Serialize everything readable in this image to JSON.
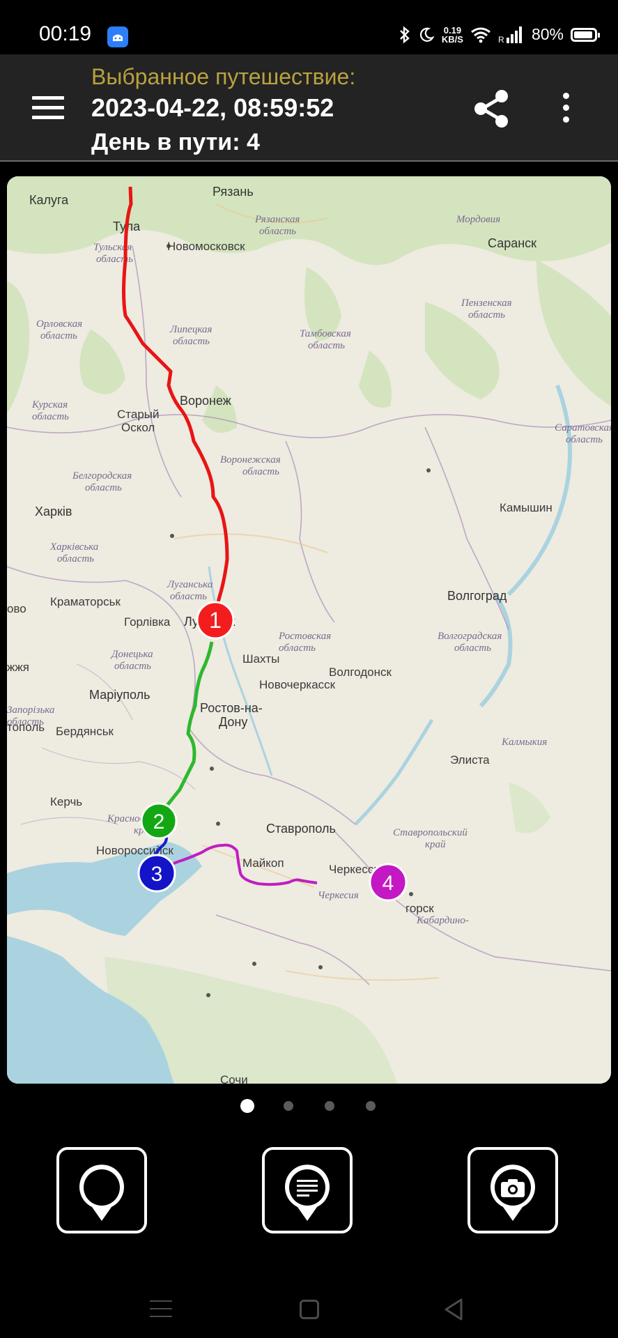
{
  "status_bar": {
    "time": "00:19",
    "speed_value": "0.19",
    "speed_unit": "KB/S",
    "battery": "80%",
    "icons": [
      "app-icon",
      "bluetooth-icon",
      "moon-icon",
      "wifi-icon",
      "signal-icon",
      "battery-icon"
    ]
  },
  "header": {
    "subtitle": "Выбранное путешествие:",
    "title": "2023-04-22, 08:59:52",
    "day_label": "День в пути: 4",
    "icons": [
      "menu-icon",
      "share-icon",
      "more-vert-icon"
    ]
  },
  "map": {
    "cities": [
      "Калуга",
      "Рязань",
      "Тула",
      "Новомосковск",
      "Саранск",
      "Воронеж",
      "Старый Оскол",
      "Харків",
      "Камышин",
      "Краматорськ",
      "Горлівка",
      "Луганськ",
      "Волгоград",
      "Шахты",
      "Волгодонск",
      "Новочеркасск",
      "Маріуполь",
      "Ростов-на-Дону",
      "Бердянськ",
      "Элиста",
      "Керчь",
      "Ставрополь",
      "Новороссийск",
      "Майкоп",
      "Черкесск",
      "Сочи"
    ],
    "regions": [
      "Рязанская область",
      "Мордовия",
      "Тульская область",
      "Пензенская область",
      "Орловская область",
      "Липецкая область",
      "Тамбовская область",
      "Курская область",
      "Саратовская область",
      "Белгородская область",
      "Воронежская область",
      "Харківська область",
      "Волгоградская область",
      "Луганська область",
      "Ростовская область",
      "Донецька область",
      "Запорізька область",
      "Калмыкия",
      "Краснодарский край",
      "Ставропольский край",
      "Черкесия",
      "Кабардино-"
    ],
    "edge_labels": [
      "ово",
      "жжя",
      "тополь",
      "горск",
      "Сочи"
    ],
    "markers": [
      {
        "label": "1",
        "color": "#f41d1d"
      },
      {
        "label": "2",
        "color": "#13a813"
      },
      {
        "label": "3",
        "color": "#1313c8"
      },
      {
        "label": "4",
        "color": "#c418c4"
      }
    ],
    "routes": [
      {
        "day": "1",
        "color": "#e81515"
      },
      {
        "day": "2",
        "color": "#2eb82e"
      },
      {
        "day": "3",
        "color": "#1a1ad0"
      },
      {
        "day": "4",
        "color": "#c01fc0"
      }
    ]
  },
  "pager": {
    "count": 4,
    "active": 1
  },
  "actions": [
    {
      "name": "place-marker",
      "icon": "map-pin-icon"
    },
    {
      "name": "note-marker",
      "icon": "note-pin-icon"
    },
    {
      "name": "photo-marker",
      "icon": "camera-pin-icon"
    }
  ],
  "nav": {
    "icons": [
      "recent-apps-icon",
      "home-icon",
      "back-icon"
    ]
  }
}
